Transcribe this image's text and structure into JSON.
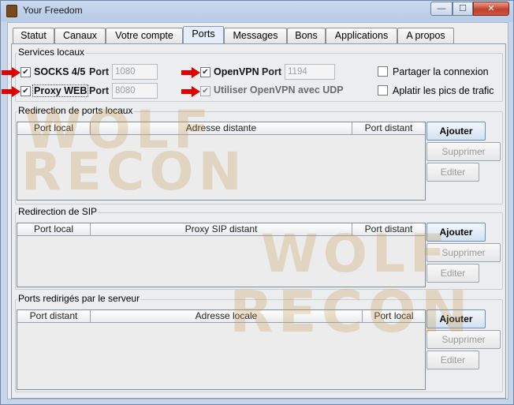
{
  "window": {
    "title": "Your Freedom",
    "controls": {
      "minimize": "—",
      "maximize": "☐",
      "close": "✕"
    }
  },
  "tabs": [
    {
      "label": "Statut",
      "active": false
    },
    {
      "label": "Canaux",
      "active": false
    },
    {
      "label": "Votre compte",
      "active": false
    },
    {
      "label": "Ports",
      "active": true
    },
    {
      "label": "Messages",
      "active": false
    },
    {
      "label": "Bons",
      "active": false
    },
    {
      "label": "Applications",
      "active": false
    },
    {
      "label": "A propos",
      "active": false
    }
  ],
  "services": {
    "title": "Services locaux",
    "socks": {
      "label": "SOCKS 4/5",
      "checked": true,
      "port_label": "Port",
      "port_value": "1080"
    },
    "proxy": {
      "label": "Proxy WEB",
      "checked": true,
      "port_label": "Port",
      "port_value": "8080"
    },
    "openvpn": {
      "label": "OpenVPN",
      "checked": true,
      "port_label": "Port",
      "port_value": "1194"
    },
    "openvpn_udp": {
      "label": "Utiliser OpenVPN avec UDP",
      "checked": true
    },
    "share": {
      "label": "Partager la connexion",
      "checked": false
    },
    "smooth": {
      "label": "Aplatir les pics de trafic",
      "checked": false
    },
    "check_glyph": "✔"
  },
  "local_redirect": {
    "title": "Redirection de ports locaux",
    "columns": [
      "Port local",
      "Adresse distante",
      "Port distant"
    ],
    "rows": [],
    "buttons": {
      "add": "Ajouter",
      "remove": "Supprimer",
      "edit": "Editer"
    }
  },
  "sip_redirect": {
    "title": "Redirection de SIP",
    "columns": [
      "Port local",
      "Proxy SIP distant",
      "Port distant"
    ],
    "rows": [],
    "buttons": {
      "add": "Ajouter",
      "remove": "Supprimer",
      "edit": "Editer"
    }
  },
  "server_ports": {
    "title": "Ports redirigés par le serveur",
    "columns": [
      "Port distant",
      "Adresse locale",
      "Port local"
    ],
    "rows": [],
    "buttons": {
      "add": "Ajouter",
      "remove": "Supprimer",
      "edit": "Editer"
    }
  },
  "watermark": {
    "line1": "WOLF",
    "line2": "RECON"
  },
  "colors": {
    "arrow": "#e10000",
    "accent": "#6d8fb9"
  }
}
